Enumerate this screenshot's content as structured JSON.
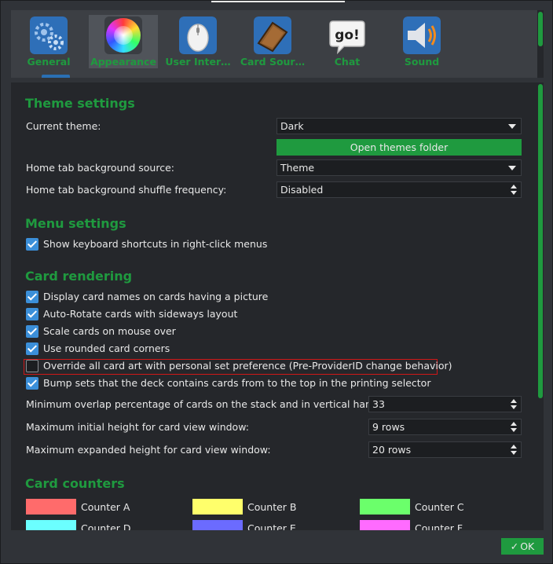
{
  "tabs": [
    {
      "label": "General",
      "icon": "gears-icon"
    },
    {
      "label": "Appearance",
      "icon": "color-wheel-icon",
      "selected": true
    },
    {
      "label": "User Inter…",
      "icon": "mouse-icon"
    },
    {
      "label": "Card Sour…",
      "icon": "card-book-icon"
    },
    {
      "label": "Chat",
      "icon": "speech-bubble-icon",
      "icon_text": "go!"
    },
    {
      "label": "Sound",
      "icon": "speaker-icon"
    }
  ],
  "theme": {
    "title": "Theme settings",
    "current_label": "Current theme:",
    "current_value": "Dark",
    "open_folder_label": "Open themes folder",
    "bg_source_label": "Home tab background source:",
    "bg_source_value": "Theme",
    "shuffle_label": "Home tab background shuffle frequency:",
    "shuffle_value": "Disabled"
  },
  "menu": {
    "title": "Menu settings",
    "shortcuts_label": "Show keyboard shortcuts in right-click menus",
    "shortcuts_checked": true
  },
  "rendering": {
    "title": "Card rendering",
    "checks": [
      {
        "label": "Display card names on cards having a picture",
        "checked": true
      },
      {
        "label": "Auto-Rotate cards with sideways layout",
        "checked": true
      },
      {
        "label": "Scale cards on mouse over",
        "checked": true
      },
      {
        "label": "Use rounded card corners",
        "checked": true
      },
      {
        "label": "Override all card art with personal set preference (Pre-ProviderID change behavior)",
        "checked": false
      },
      {
        "label": "Bump sets that the deck contains cards from to the top in the printing selector",
        "checked": true
      }
    ],
    "overlap_label": "Minimum overlap percentage of cards on the stack and in vertical hand",
    "overlap_value": "33",
    "initial_height_label": "Maximum initial height for card view window:",
    "initial_height_value": "9 rows",
    "expanded_height_label": "Maximum expanded height for card view window:",
    "expanded_height_value": "20 rows"
  },
  "counters": {
    "title": "Card counters",
    "items": [
      {
        "label": "Counter A",
        "color": "#ff6b6b"
      },
      {
        "label": "Counter B",
        "color": "#ffff6b"
      },
      {
        "label": "Counter C",
        "color": "#6bff6b"
      },
      {
        "label": "Counter D",
        "color": "#6bffff"
      },
      {
        "label": "Counter E",
        "color": "#6b6bff"
      },
      {
        "label": "Counter F",
        "color": "#ff6bff"
      }
    ]
  },
  "ok_label": "OK",
  "colors": {
    "accent": "#1f9a3f",
    "check": "#3b8fd9",
    "highlight": "#d01818"
  }
}
